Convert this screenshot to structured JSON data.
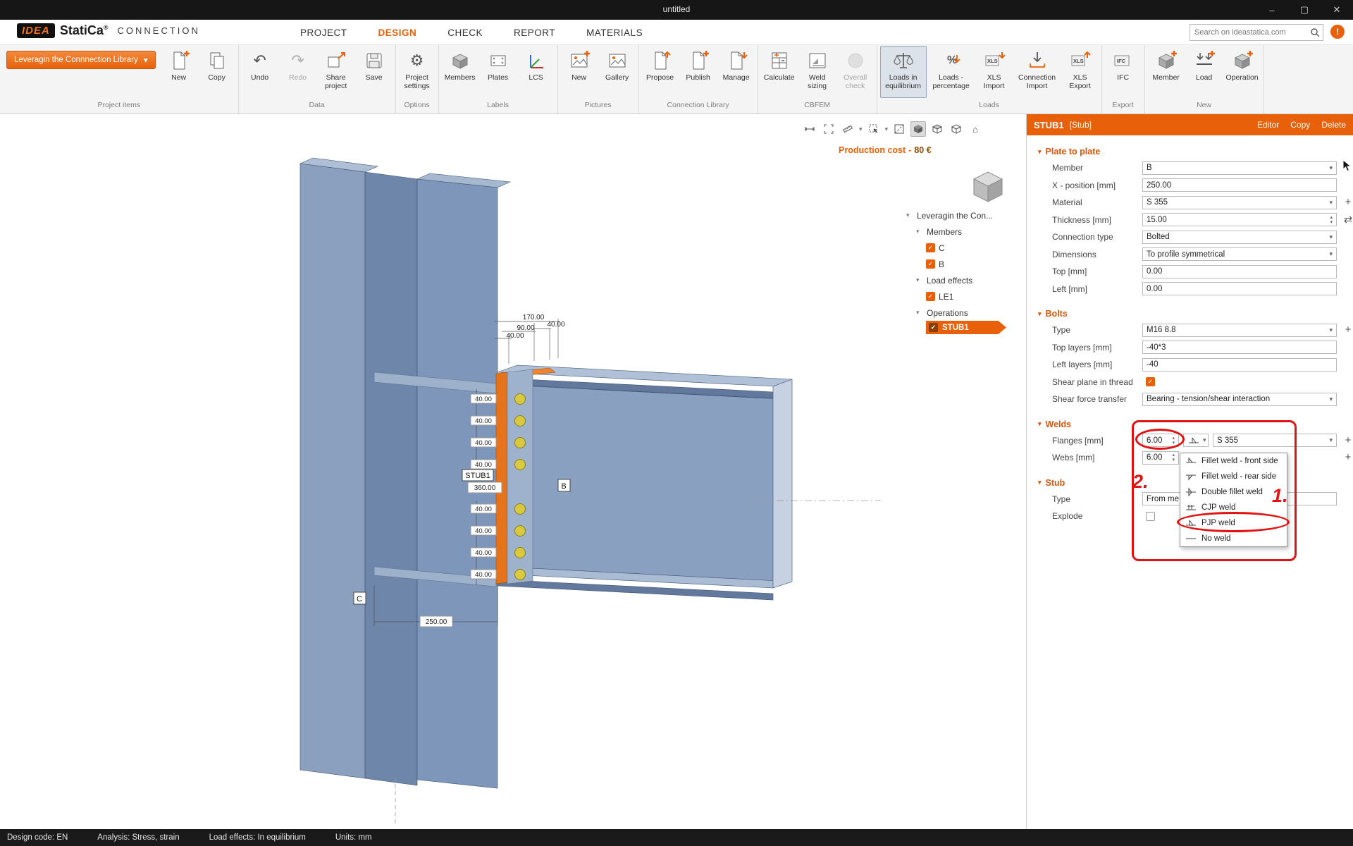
{
  "window": {
    "title": "untitled"
  },
  "brand": {
    "idea": "IDEA",
    "statica": "StatiCa",
    "reg": "®",
    "product": "CONNECTION"
  },
  "menu": {
    "tabs": [
      "PROJECT",
      "DESIGN",
      "CHECK",
      "REPORT",
      "MATERIALS"
    ]
  },
  "search": {
    "placeholder": "Search on ideastatica.com"
  },
  "ribbon": {
    "library_button": "Leveragin the Connnection Library",
    "groups": [
      {
        "label": "Project items",
        "buttons": [
          "New",
          "Copy"
        ]
      },
      {
        "label": "Data",
        "buttons": [
          "Undo",
          "Redo",
          "Share project",
          "Save"
        ]
      },
      {
        "label": "Options",
        "buttons": [
          "Project settings"
        ]
      },
      {
        "label": "Labels",
        "buttons": [
          "Members",
          "Plates",
          "LCS"
        ]
      },
      {
        "label": "Pictures",
        "buttons": [
          "New",
          "Gallery"
        ]
      },
      {
        "label": "Connection Library",
        "buttons": [
          "Propose",
          "Publish",
          "Manage"
        ]
      },
      {
        "label": "CBFEM",
        "buttons": [
          "Calculate",
          "Weld sizing",
          "Overall check"
        ]
      },
      {
        "label": "Loads",
        "buttons": [
          "Loads in equilibrium",
          "Loads - percentage",
          "XLS Import",
          "Connection Import",
          "XLS Export"
        ]
      },
      {
        "label": "Export",
        "buttons": [
          "IFC"
        ]
      },
      {
        "label": "New",
        "buttons": [
          "Member",
          "Load",
          "Operation"
        ]
      }
    ]
  },
  "viewport": {
    "production_cost_label": "Production cost",
    "production_cost_sep": "-",
    "production_cost_value": "80 €",
    "labels": {
      "stub": "STUB1",
      "plate_height": "360.00",
      "beam": "B",
      "column": "C",
      "bottom_dim": "250.00"
    },
    "dims": {
      "top": [
        "40.00",
        "90.00",
        "170.00",
        "40.00"
      ],
      "left": [
        "40.00",
        "40.00",
        "40.00",
        "40.00",
        "40.00",
        "40.00",
        "40.00",
        "40.00"
      ]
    }
  },
  "tree": {
    "root": "Leveragin the Con...",
    "members_header": "Members",
    "members": [
      "C",
      "B"
    ],
    "loads_header": "Load effects",
    "loads": [
      "LE1"
    ],
    "operations_header": "Operations",
    "operations": [
      "STUB1"
    ]
  },
  "panel": {
    "title": "STUB1",
    "subtitle": "[Stub]",
    "actions": [
      "Editor",
      "Copy",
      "Delete"
    ],
    "sections": {
      "plate": {
        "title": "Plate to plate",
        "rows": [
          {
            "label": "Member",
            "value": "B"
          },
          {
            "label": "X - position [mm]",
            "value": "250.00"
          },
          {
            "label": "Material",
            "value": "S 355"
          },
          {
            "label": "Thickness [mm]",
            "value": "15.00"
          },
          {
            "label": "Connection type",
            "value": "Bolted"
          },
          {
            "label": "Dimensions",
            "value": "To profile symmetrical"
          },
          {
            "label": "Top [mm]",
            "value": "0.00"
          },
          {
            "label": "Left [mm]",
            "value": "0.00"
          }
        ]
      },
      "bolts": {
        "title": "Bolts",
        "rows": [
          {
            "label": "Type",
            "value": "M16 8.8"
          },
          {
            "label": "Top layers [mm]",
            "value": "-40*3"
          },
          {
            "label": "Left layers [mm]",
            "value": "-40"
          },
          {
            "label": "Shear plane in thread",
            "value": "checked"
          },
          {
            "label": "Shear force transfer",
            "value": "Bearing - tension/shear interaction"
          }
        ]
      },
      "welds": {
        "title": "Welds",
        "flanges_label": "Flanges [mm]",
        "flanges_value": "6.00",
        "flanges_material": "S 355",
        "webs_label": "Webs [mm]",
        "webs_value": "6.00"
      },
      "stub": {
        "title": "Stub",
        "type_label": "Type",
        "type_value": "From me",
        "explode_label": "Explode"
      }
    }
  },
  "weld_dropdown": [
    "Fillet weld - front side",
    "Fillet weld - rear side",
    "Double fillet weld",
    "CJP weld",
    "PJP weld",
    "No weld"
  ],
  "annotations": {
    "step1": "1.",
    "step2": "2."
  },
  "status": [
    "Design code: EN",
    "Analysis: Stress, strain",
    "Load effects: In equilibrium",
    "Units: mm"
  ],
  "icons": {
    "chevron_down": "▾",
    "caret_up": "▴",
    "caret_down": "▾",
    "check": "✓",
    "plus": "+",
    "swap": "⇄",
    "undo": "↶",
    "redo": "↷",
    "gear": "⚙",
    "info": "!",
    "close": "✕",
    "minimize": "–",
    "maximize": "▢",
    "home": "⌂"
  },
  "colors": {
    "accent": "#e8610a",
    "annotation": "#e31212",
    "steel": "#7e96b9",
    "plate": "#e8761b",
    "bolt": "#d9c93f"
  }
}
